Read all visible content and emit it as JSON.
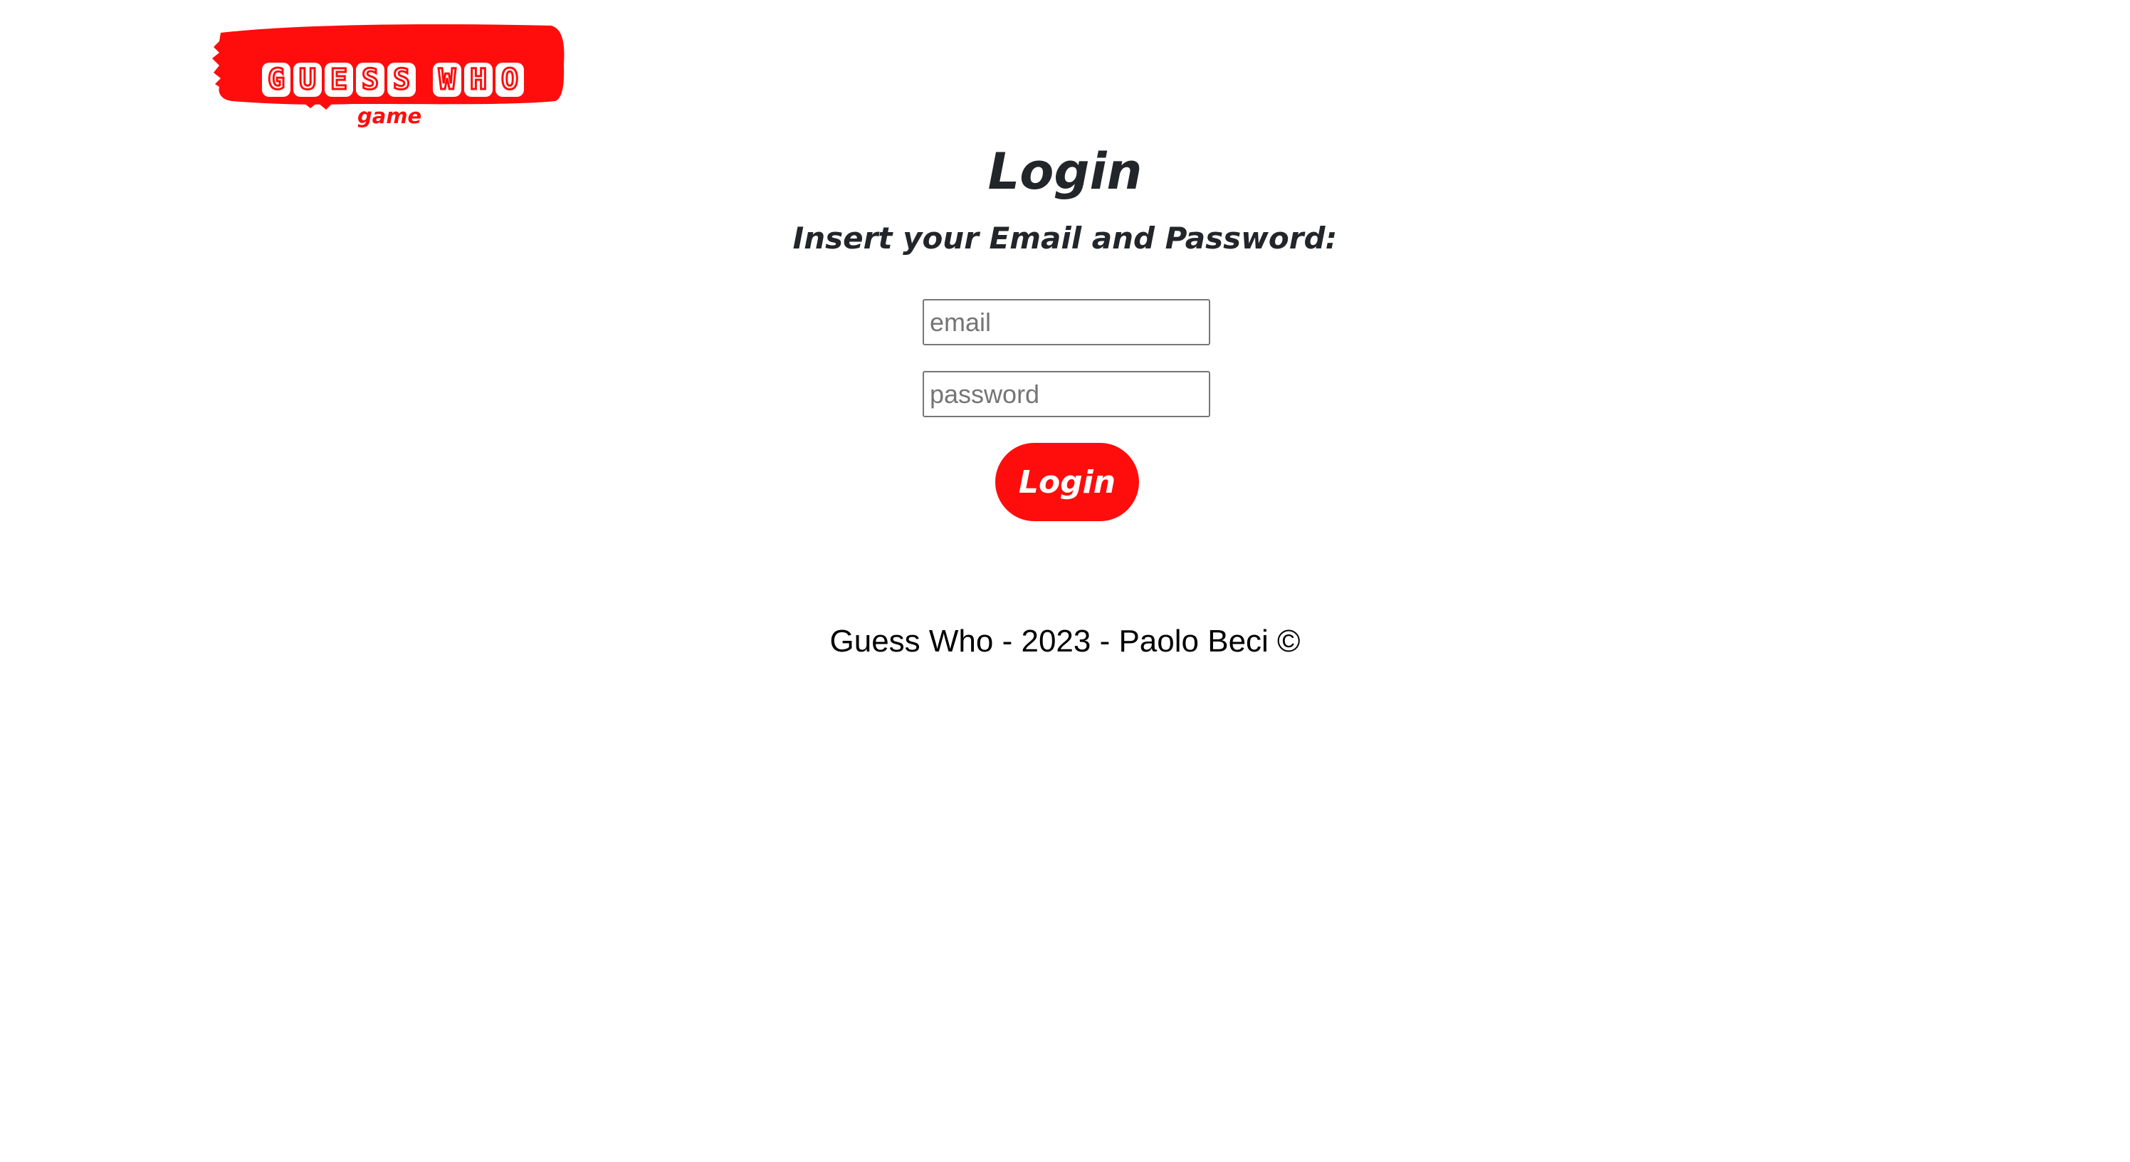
{
  "logo": {
    "letters_word1": [
      "G",
      "U",
      "E",
      "S",
      "S"
    ],
    "letters_word2": [
      "W",
      "H",
      "O"
    ],
    "subtitle": "game",
    "brand_color": "#ff0d0d"
  },
  "login": {
    "title": "Login",
    "instructions": "Insert your Email and Password:",
    "email_placeholder": "email",
    "password_placeholder": "password",
    "email_value": "",
    "password_value": "",
    "button_label": "Login",
    "button_color": "#ff0d0d"
  },
  "footer": {
    "text": "Guess Who - 2023 - Paolo Beci ©"
  }
}
